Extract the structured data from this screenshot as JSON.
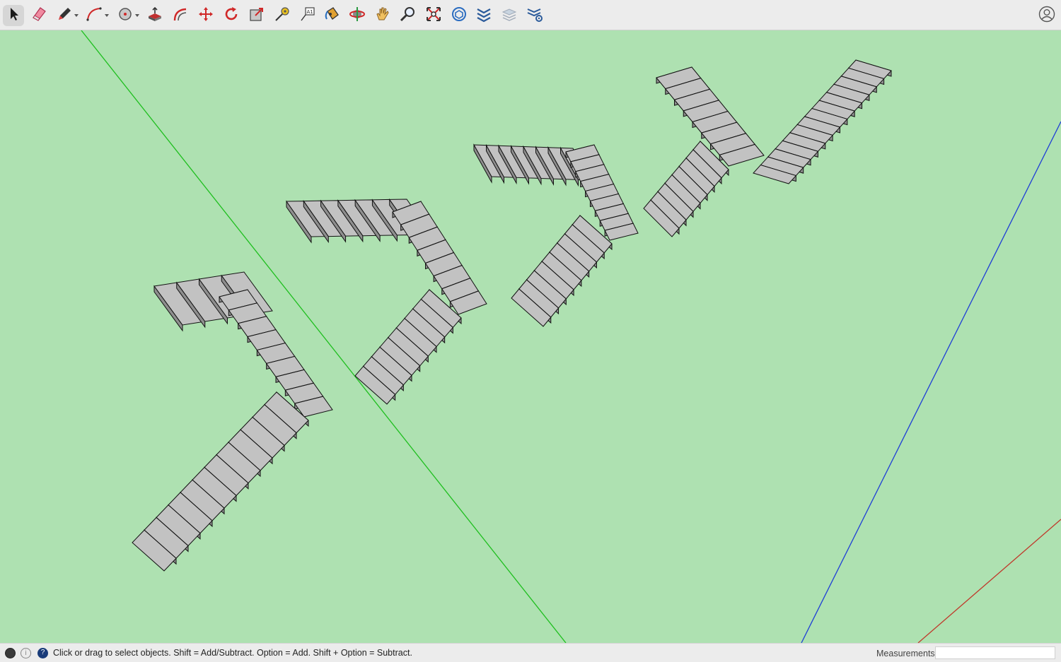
{
  "toolbar": {
    "tools": [
      {
        "name": "select-tool",
        "icon": "select-arrow-icon",
        "active": true
      },
      {
        "name": "eraser-tool",
        "icon": "eraser-icon"
      },
      {
        "name": "line-tool",
        "icon": "pencil-icon",
        "has_dropdown": true
      },
      {
        "name": "arc-tool",
        "icon": "arc-icon",
        "has_dropdown": true
      },
      {
        "name": "shapes-tool",
        "icon": "circle-shape-icon",
        "has_dropdown": true
      },
      {
        "name": "push-pull-tool",
        "icon": "push-pull-icon"
      },
      {
        "name": "offset-tool",
        "icon": "offset-icon"
      },
      {
        "name": "move-tool",
        "icon": "move-icon"
      },
      {
        "name": "rotate-tool",
        "icon": "rotate-icon"
      },
      {
        "name": "scale-tool",
        "icon": "scale-icon"
      },
      {
        "name": "tape-measure-tool",
        "icon": "tape-measure-icon"
      },
      {
        "name": "text-tool",
        "icon": "text-icon"
      },
      {
        "name": "paint-bucket-tool",
        "icon": "paint-bucket-icon"
      },
      {
        "name": "orbit-tool",
        "icon": "orbit-icon"
      },
      {
        "name": "pan-tool",
        "icon": "hand-icon"
      },
      {
        "name": "zoom-tool",
        "icon": "magnifier-icon"
      },
      {
        "name": "zoom-extents-tool",
        "icon": "zoom-extents-icon"
      },
      {
        "name": "3d-warehouse-button",
        "icon": "warehouse-icon"
      },
      {
        "name": "extension-warehouse-button",
        "icon": "extension-warehouse-icon"
      },
      {
        "name": "layers-button",
        "icon": "layers-icon"
      },
      {
        "name": "layers-settings-button",
        "icon": "layers-gear-icon"
      }
    ],
    "account_icon": "user-account-icon"
  },
  "colors": {
    "ground": "#aee1b1",
    "toolbar_bg": "#ececec",
    "green_axis": "#1fbf1f",
    "blue_axis": "#1f3fd6",
    "red_axis": "#c0392b",
    "stair_top": "#c2c2c2",
    "stair_riser": "#8e8e8e",
    "stair_edge": "#111111"
  },
  "status": {
    "message": "Click or drag to select objects. Shift = Add/Subtract. Option = Add. Shift + Option = Subtract.",
    "icons": [
      "geo-location-icon",
      "credits-icon",
      "help-icon"
    ]
  },
  "measurements": {
    "label": "Measurements",
    "value": ""
  }
}
